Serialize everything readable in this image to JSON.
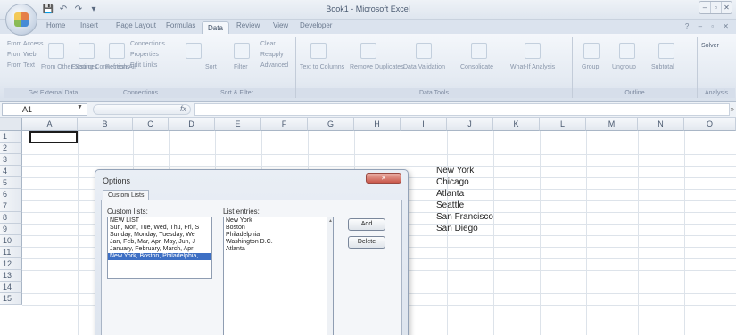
{
  "window": {
    "title": "Book1 - Microsoft Excel",
    "controls": [
      "–",
      "▫",
      "✕"
    ]
  },
  "qat": {
    "save": "💾",
    "undo": "↶",
    "redo": "↷",
    "more": "▾"
  },
  "ribbon_tabs": [
    "Home",
    "Insert",
    "Page Layout",
    "Formulas",
    "Data",
    "Review",
    "View",
    "Developer"
  ],
  "ribbon_tabs_right": "? – ▫ ✕",
  "ribbon": {
    "groups": [
      {
        "label": "Get External Data",
        "items": [
          "From Access",
          "From Web",
          "From Text",
          "From Other Sources",
          "Existing Connections"
        ]
      },
      {
        "label": "Connections",
        "items": [
          "Refresh All",
          "Connections",
          "Properties",
          "Edit Links"
        ]
      },
      {
        "label": "Sort & Filter",
        "items": [
          "Sort",
          "Filter",
          "Clear",
          "Reapply",
          "Advanced"
        ]
      },
      {
        "label": "Data Tools",
        "items": [
          "Text to Columns",
          "Remove Duplicates",
          "Data Validation",
          "Consolidate",
          "What-If Analysis"
        ]
      },
      {
        "label": "Outline",
        "items": [
          "Group",
          "Ungroup",
          "Subtotal"
        ]
      },
      {
        "label": "Analysis",
        "items": [
          "Solver"
        ]
      }
    ]
  },
  "formula_bar": {
    "name_box": "A1",
    "fx": "fx",
    "value": ""
  },
  "columns": [
    "A",
    "B",
    "C",
    "D",
    "E",
    "F",
    "G",
    "H",
    "I",
    "J",
    "K",
    "L",
    "M",
    "N",
    "O"
  ],
  "rows": [
    "1",
    "2",
    "3",
    "4",
    "5",
    "6",
    "7",
    "8",
    "9",
    "10",
    "11",
    "12",
    "13",
    "14",
    "15"
  ],
  "cells": {
    "J3": "New York",
    "J4": "Chicago",
    "J5": "Atlanta",
    "J6": "Seattle",
    "J7": "San Francisco",
    "J8": "San Diego"
  },
  "dialog": {
    "title": "Options",
    "close": "✕",
    "tab": "Custom Lists",
    "custom_lists_label": "Custom lists:",
    "list_entries_label": "List entries:",
    "custom_lists": [
      "NEW LIST",
      "Sun, Mon, Tue, Wed, Thu, Fri, S",
      "Sunday, Monday, Tuesday, We",
      "Jan, Feb, Mar, Apr, May, Jun, J",
      "January, February, March, Apri",
      "New York, Boston, Philadelphia,"
    ],
    "selected_list_index": 5,
    "list_entries": [
      "New York",
      "Boston",
      "Philadelphia",
      "Washington D.C.",
      "Atlanta"
    ],
    "add_button": "Add",
    "delete_button": "Delete"
  }
}
